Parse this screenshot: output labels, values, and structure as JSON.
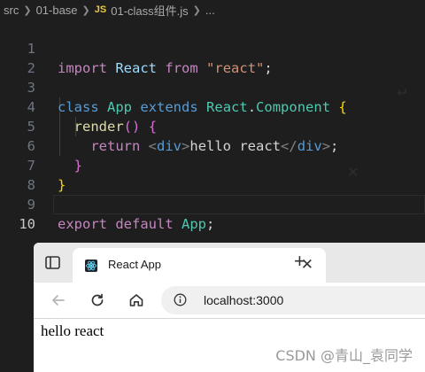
{
  "breadcrumb": {
    "segments": [
      "src",
      "01-base"
    ],
    "file_badge": "JS",
    "file_name": "01-class组件.js",
    "ellipsis": "..."
  },
  "editor": {
    "line_numbers": [
      "1",
      "2",
      "3",
      "4",
      "5",
      "6",
      "7",
      "8",
      "9",
      "10"
    ],
    "current_line": "10",
    "lines": [
      {
        "t1": "import",
        "t2": "React",
        "t3": "from",
        "t4": "\"react\"",
        "t5": ";"
      },
      {},
      {
        "t1": "class",
        "t2": "App",
        "t3": "extends",
        "t4": "React",
        "t5": ".",
        "t6": "Component",
        "t7": "{"
      },
      {
        "t1": "render",
        "t2": "()",
        "t3": "{"
      },
      {
        "t1": "return",
        "t2": "<",
        "t3": "div",
        "t4": ">",
        "t5": "hello react",
        "t6": "</",
        "t7": "div",
        "t8": ">",
        "t9": ";"
      },
      {
        "t1": "}"
      },
      {
        "t1": "}"
      },
      {},
      {
        "t1": "export",
        "t2": "default",
        "t3": "App",
        "t4": ";"
      },
      {}
    ]
  },
  "browser": {
    "tab_title": "React App",
    "tab_close": "✕",
    "new_tab": "+",
    "url": "localhost:3000",
    "page_text": "hello react"
  },
  "watermark": "CSDN @青山_袁同学",
  "colors": {
    "editor_bg": "#1e1e1e",
    "keyword": "#569cd6",
    "control_keyword": "#c586c0",
    "class_name": "#4ec9b0",
    "function": "#dcdcaa",
    "string": "#ce9178",
    "bracket_gold": "#ffd700",
    "bracket_orchid": "#da70d6"
  },
  "icons": [
    "chevron-right-icon",
    "js-file-icon",
    "tab-actions-icon",
    "react-favicon-icon",
    "close-icon",
    "plus-icon",
    "back-arrow-icon",
    "reload-icon",
    "home-icon",
    "info-icon"
  ]
}
